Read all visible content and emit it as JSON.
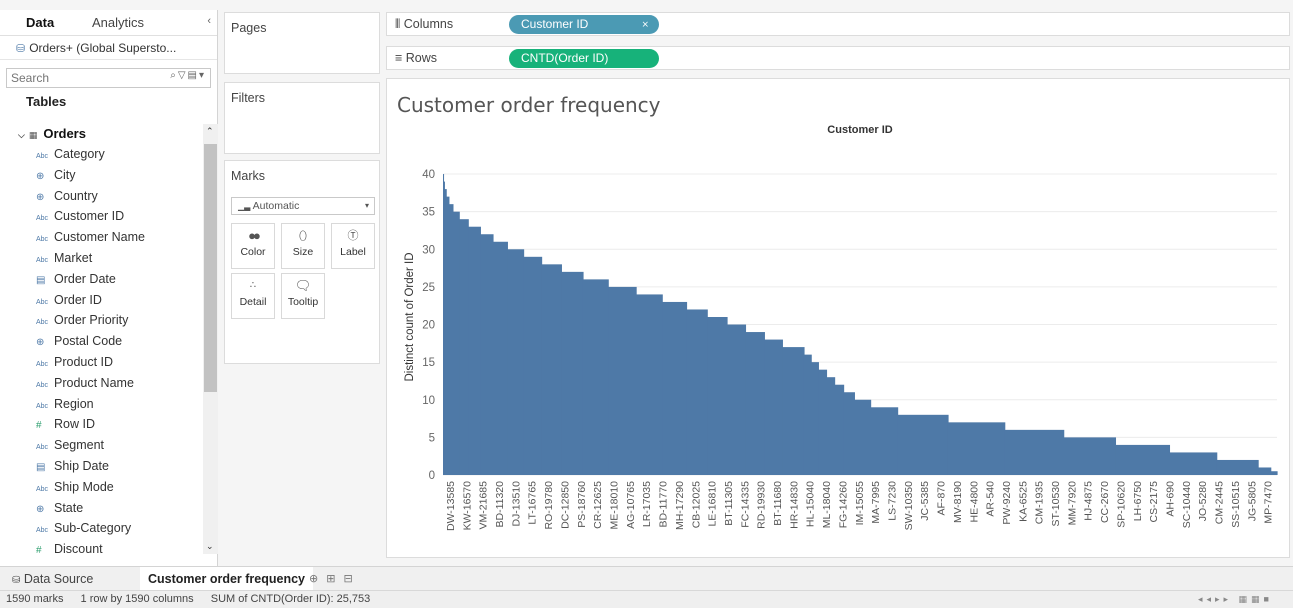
{
  "data_pane": {
    "tab_data": "Data",
    "tab_analytics": "Analytics",
    "datasource": "Orders+ (Global Supersto...",
    "search_placeholder": "Search",
    "tables_heading": "Tables",
    "table_name": "Orders",
    "fields": [
      {
        "type": "Abc",
        "name": "Category"
      },
      {
        "type": "geo",
        "name": "City"
      },
      {
        "type": "geo",
        "name": "Country"
      },
      {
        "type": "Abc",
        "name": "Customer ID"
      },
      {
        "type": "Abc",
        "name": "Customer Name"
      },
      {
        "type": "Abc",
        "name": "Market"
      },
      {
        "type": "date",
        "name": "Order Date"
      },
      {
        "type": "Abc",
        "name": "Order ID"
      },
      {
        "type": "Abc",
        "name": "Order Priority"
      },
      {
        "type": "geo",
        "name": "Postal Code"
      },
      {
        "type": "Abc",
        "name": "Product ID"
      },
      {
        "type": "Abc",
        "name": "Product Name"
      },
      {
        "type": "Abc",
        "name": "Region"
      },
      {
        "type": "num",
        "name": "Row ID"
      },
      {
        "type": "Abc",
        "name": "Segment"
      },
      {
        "type": "date",
        "name": "Ship Date"
      },
      {
        "type": "Abc",
        "name": "Ship Mode"
      },
      {
        "type": "geo",
        "name": "State"
      },
      {
        "type": "Abc",
        "name": "Sub-Category"
      },
      {
        "type": "num",
        "name": "Discount"
      }
    ]
  },
  "shelves": {
    "pages": "Pages",
    "filters": "Filters",
    "marks": "Marks",
    "mark_type": "Automatic",
    "color": "Color",
    "size": "Size",
    "label": "Label",
    "detail": "Detail",
    "tooltip": "Tooltip",
    "columns_label": "Columns",
    "rows_label": "Rows",
    "columns_pill": "Customer ID",
    "rows_pill": "CNTD(Order ID)"
  },
  "viz": {
    "title": "Customer order frequency"
  },
  "chart_data": {
    "type": "bar",
    "title": "Customer ID",
    "xlabel": "",
    "ylabel": "Distinct count of Order ID",
    "ylim": [
      0,
      42
    ],
    "yticks": [
      0,
      5,
      10,
      15,
      20,
      25,
      30,
      35,
      40
    ],
    "total_customers": 1590,
    "x_tick_labels": [
      "DW-13585",
      "KW-16570",
      "VM-21685",
      "BD-11320",
      "DJ-13510",
      "LT-16765",
      "RO-19780",
      "DC-12850",
      "PS-18760",
      "CR-12625",
      "ME-18010",
      "AG-10765",
      "LR-17035",
      "BD-11770",
      "MH-17290",
      "CB-12025",
      "LE-16810",
      "BT-11305",
      "FC-14335",
      "RD-19930",
      "BT-11680",
      "HR-14830",
      "HL-15040",
      "ML-18040",
      "FG-14260",
      "IM-15055",
      "MA-7995",
      "LS-7230",
      "SW-10350",
      "JC-5385",
      "AF-870",
      "MV-8190",
      "HE-4800",
      "AR-540",
      "PW-9240",
      "KA-6525",
      "CM-1935",
      "ST-10530",
      "MM-7920",
      "HJ-4875",
      "CC-2670",
      "SP-10620",
      "LH-6750",
      "CS-2175",
      "AH-690",
      "SC-10440",
      "JO-5280",
      "CM-2445",
      "SS-10515",
      "JG-5805",
      "MP-7470"
    ],
    "series": [
      {
        "values": [
          40,
          39,
          38,
          37,
          36,
          35,
          34,
          33,
          32,
          31,
          30,
          29,
          28,
          27,
          26,
          25,
          24,
          23,
          22,
          21,
          20,
          19,
          18,
          17,
          16,
          15,
          14,
          13,
          12,
          11,
          10,
          9,
          8,
          7,
          6,
          5,
          4,
          3,
          2,
          1,
          0.5
        ]
      }
    ],
    "step_counts": [
      1,
      2,
      4,
      6,
      9,
      14,
      20,
      27,
      28,
      32,
      36,
      40,
      44,
      48,
      56,
      62,
      58,
      54,
      46,
      44,
      41,
      42,
      40,
      48,
      16,
      16,
      18,
      18,
      20,
      24,
      36,
      60,
      112,
      126,
      131,
      115,
      120,
      105,
      92,
      28,
      14
    ],
    "color": "#4e79a7"
  },
  "bottom": {
    "datasource_tab": "Data Source",
    "sheet_tab": "Customer order frequency"
  },
  "status": {
    "marks": "1590 marks",
    "dims": "1 row by 1590 columns",
    "sum": "SUM of CNTD(Order ID): 25,753"
  }
}
